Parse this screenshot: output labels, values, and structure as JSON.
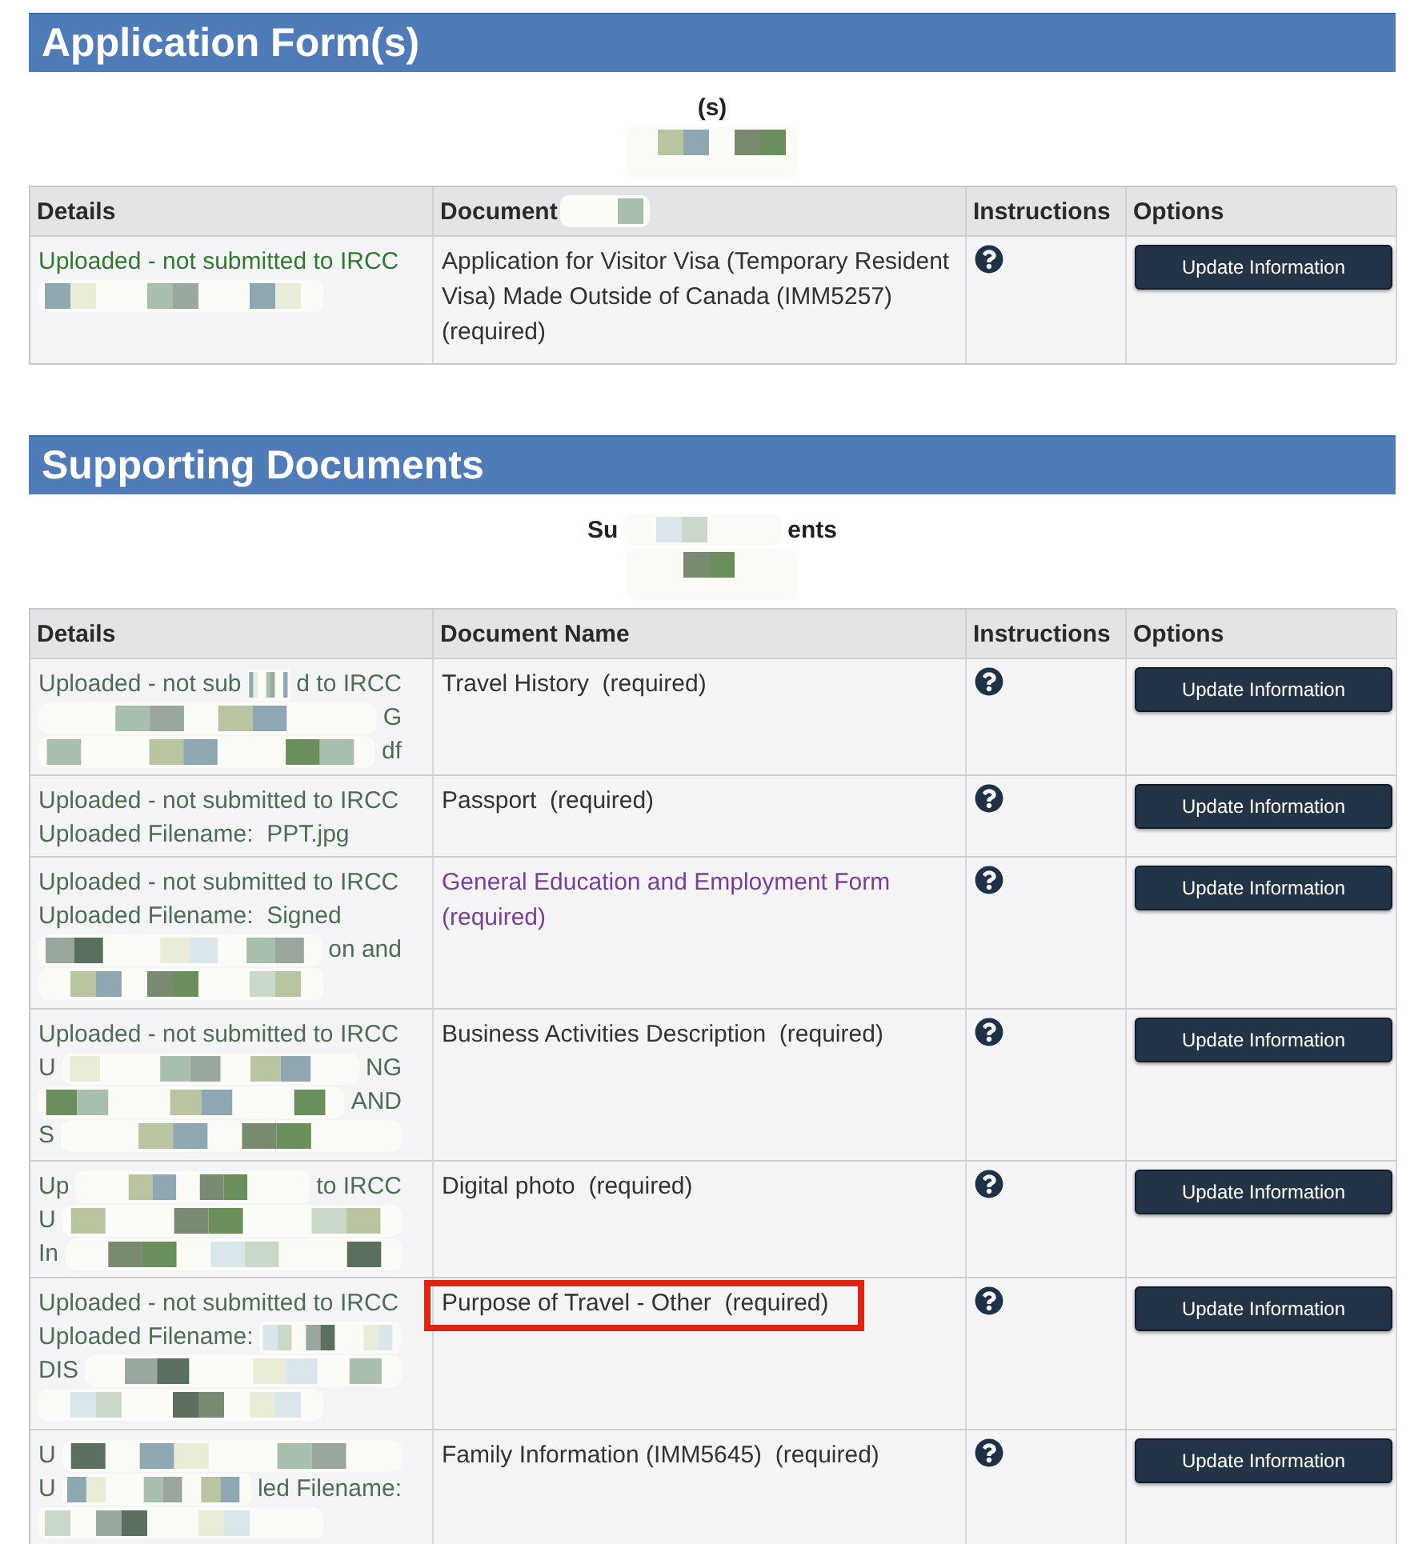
{
  "sections": [
    {
      "title": "Application Form(s)",
      "caption_parts": [
        "(s)"
      ],
      "columns": [
        {
          "label": "Details"
        },
        {
          "label": "Document",
          "redacted": true
        },
        {
          "label": "Instructions"
        },
        {
          "label": "Options"
        }
      ],
      "rows": [
        {
          "details": [
            {
              "kind": "full",
              "parts": [
                "Uploaded - not submitted to IRCC"
              ]
            }
          ],
          "redacted": true,
          "document": "Application for Visitor Visa (Temporary Resident Visa) Made Outside of Canada (IMM5257)  (required)",
          "link": false,
          "highlighted": false,
          "button": "Update Information"
        }
      ]
    },
    {
      "title": "Supporting Documents",
      "caption_parts": [
        "Su",
        "ents"
      ],
      "columns": [
        {
          "label": "Details"
        },
        {
          "label": "Document Name"
        },
        {
          "label": "Instructions"
        },
        {
          "label": "Options"
        }
      ],
      "rows": [
        {
          "details": [
            {
              "kind": "split",
              "parts": [
                "Uploaded - not sub",
                "d to IRCC"
              ]
            },
            {
              "kind": "right",
              "parts": [
                "G"
              ]
            },
            {
              "kind": "right",
              "parts": [
                "df"
              ]
            }
          ],
          "document": "Travel History  (required)",
          "link": false,
          "highlighted": false,
          "button": "Update Information"
        },
        {
          "details": [
            {
              "kind": "full",
              "parts": [
                "Uploaded - not submitted to IRCC"
              ]
            },
            {
              "kind": "full",
              "parts": [
                "Uploaded Filename:  PPT.jpg"
              ]
            }
          ],
          "document": "Passport  (required)",
          "link": false,
          "highlighted": false,
          "button": "Update Information"
        },
        {
          "details": [
            {
              "kind": "full",
              "parts": [
                "Uploaded - not submitted to IRCC"
              ]
            },
            {
              "kind": "full",
              "parts": [
                "Uploaded Filename:  Signed"
              ]
            },
            {
              "kind": "right",
              "parts": [
                "on and"
              ]
            }
          ],
          "redacted": true,
          "document": "General Education and Employment Form  (required)",
          "link": true,
          "highlighted": false,
          "button": "Update Information"
        },
        {
          "details": [
            {
              "kind": "full",
              "parts": [
                "Uploaded - not submitted to IRCC"
              ]
            },
            {
              "kind": "split",
              "parts": [
                "U",
                "NG"
              ]
            },
            {
              "kind": "right",
              "parts": [
                "AND"
              ]
            },
            {
              "kind": "partial",
              "parts": [
                "S"
              ]
            }
          ],
          "document": "Business Activities Description  (required)",
          "link": false,
          "highlighted": false,
          "button": "Update Information"
        },
        {
          "details": [
            {
              "kind": "split",
              "parts": [
                "Up",
                "to IRCC"
              ]
            },
            {
              "kind": "partial",
              "parts": [
                "U"
              ]
            },
            {
              "kind": "partial",
              "parts": [
                "In"
              ]
            }
          ],
          "document": "Digital photo  (required)",
          "link": false,
          "highlighted": false,
          "button": "Update Information"
        },
        {
          "details": [
            {
              "kind": "full",
              "parts": [
                "Uploaded - not submitted to IRCC"
              ]
            },
            {
              "kind": "partial",
              "parts": [
                "Uploaded Filename:"
              ]
            },
            {
              "kind": "partial",
              "parts": [
                "DIS"
              ]
            }
          ],
          "redacted": true,
          "document": "Purpose of Travel - Other  (required)",
          "link": false,
          "highlighted": true,
          "button": "Update Information"
        },
        {
          "details": [
            {
              "kind": "partial",
              "parts": [
                "U"
              ]
            },
            {
              "kind": "split",
              "parts": [
                "U",
                "led Filename:"
              ]
            }
          ],
          "redacted": true,
          "document": "Family Information (IMM5645)  (required)",
          "link": false,
          "highlighted": false,
          "button": "Update Information"
        }
      ]
    }
  ]
}
